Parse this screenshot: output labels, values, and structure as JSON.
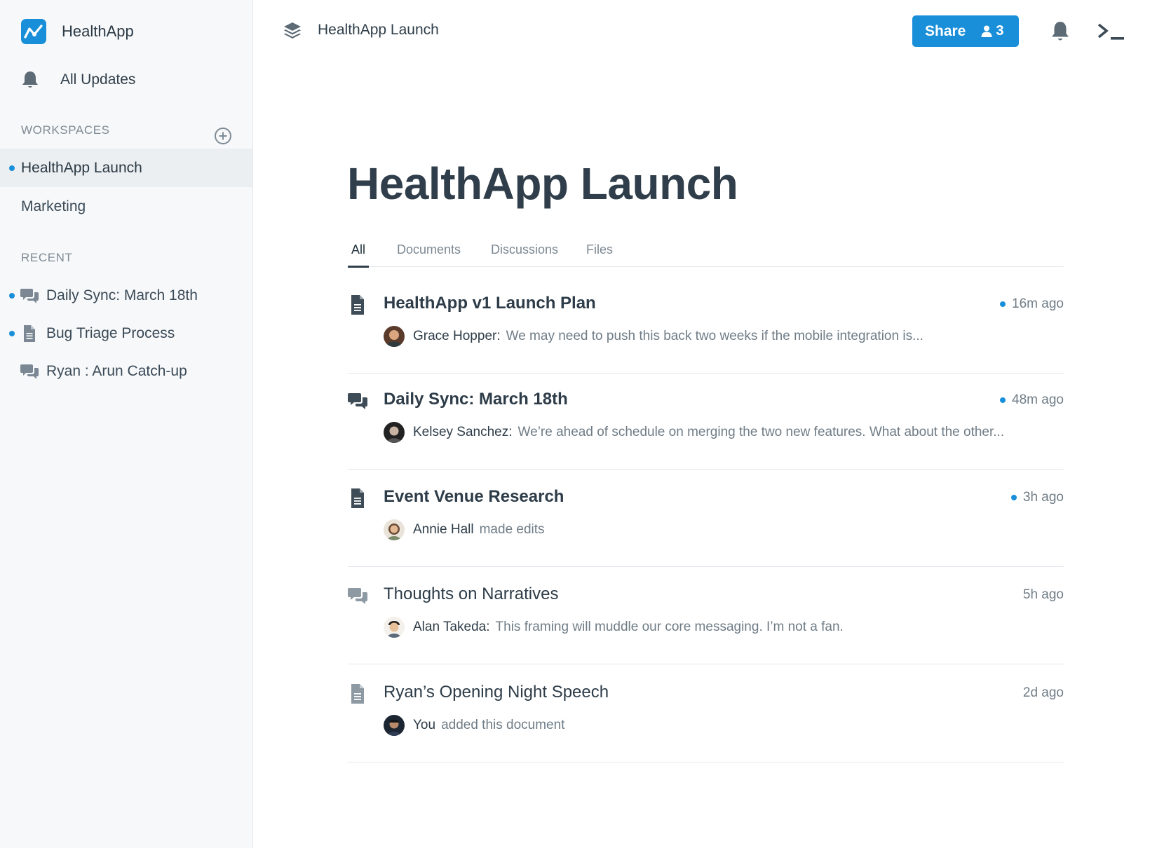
{
  "sidebar": {
    "brand": "HealthApp",
    "all_updates": "All Updates",
    "workspaces_label": "WORKSPACES",
    "workspaces": [
      {
        "label": "HealthApp Launch",
        "active": true
      },
      {
        "label": "Marketing",
        "active": false
      }
    ],
    "recent_label": "RECENT",
    "recent": [
      {
        "label": "Daily Sync: March 18th",
        "icon": "chat-icon",
        "unread": true
      },
      {
        "label": "Bug Triage Process",
        "icon": "document-icon",
        "unread": true
      },
      {
        "label": "Ryan : Arun Catch-up",
        "icon": "chat-icon",
        "unread": false
      }
    ]
  },
  "topbar": {
    "breadcrumb": "HealthApp Launch",
    "share_label": "Share",
    "member_count": "3"
  },
  "main": {
    "title": "HealthApp Launch",
    "tabs": [
      "All",
      "Documents",
      "Discussions",
      "Files"
    ],
    "active_tab": "All",
    "feed": [
      {
        "title": "HealthApp v1 Launch Plan",
        "type": "document",
        "time": "16m ago",
        "unread": true,
        "author": "Grace Hopper:",
        "text": "We may need to push this back two weeks if the mobile integration is..."
      },
      {
        "title": "Daily Sync: March 18th",
        "type": "discussion",
        "time": "48m ago",
        "unread": true,
        "author": "Kelsey Sanchez:",
        "text": "We’re ahead of schedule on merging the two new features. What about the other..."
      },
      {
        "title": "Event Venue Research",
        "type": "document",
        "time": "3h ago",
        "unread": true,
        "author": "Annie Hall",
        "text": "made edits"
      },
      {
        "title": "Thoughts on Narratives",
        "type": "discussion",
        "time": "5h ago",
        "unread": false,
        "author": "Alan Takeda:",
        "text": "This framing will muddle our core messaging. I’m not a fan."
      },
      {
        "title": "Ryan’s Opening Night Speech",
        "type": "document",
        "time": "2d ago",
        "unread": false,
        "author": "You",
        "text": "added this document"
      }
    ]
  },
  "colors": {
    "accent": "#1a8fd9",
    "sidebar_bg": "#f7f8fa",
    "text_dark": "#2d3c48",
    "text_muted": "#6f7c86"
  }
}
